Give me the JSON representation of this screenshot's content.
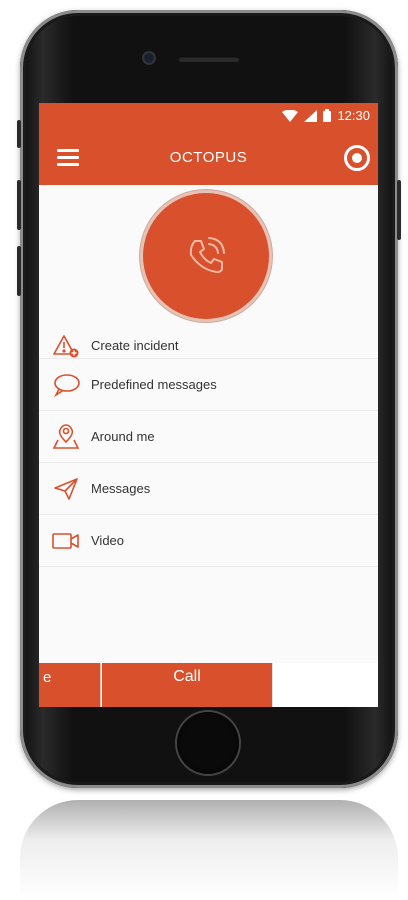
{
  "status": {
    "time": "12:30"
  },
  "appbar": {
    "title": "OCTOPUS"
  },
  "menu": {
    "items": [
      {
        "label": "Create incident",
        "icon": "warning-plus-icon"
      },
      {
        "label": "Predefined messages",
        "icon": "chat-bubble-icon"
      },
      {
        "label": "Around me",
        "icon": "location-pin-icon"
      },
      {
        "label": "Messages",
        "icon": "paper-plane-icon"
      },
      {
        "label": "Video",
        "icon": "video-camera-icon"
      }
    ]
  },
  "bottom": {
    "left_label": "e",
    "call_label": "Call"
  },
  "colors": {
    "accent": "#d9512c",
    "background": "#fafafa"
  }
}
